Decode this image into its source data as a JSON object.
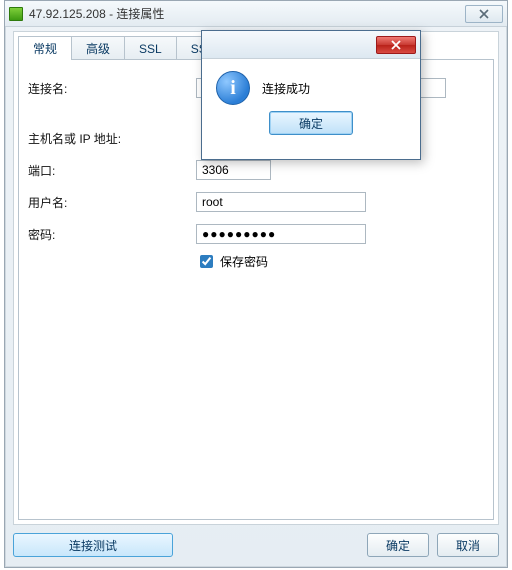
{
  "window": {
    "title": "47.92.125.208 - 连接属性"
  },
  "tabs": [
    {
      "label": "常规",
      "active": true
    },
    {
      "label": "高级",
      "active": false
    },
    {
      "label": "SSL",
      "active": false
    },
    {
      "label": "SSH",
      "active": false
    }
  ],
  "form": {
    "connection_name_label": "连接名:",
    "connection_name_value": "",
    "host_label": "主机名或 IP 地址:",
    "host_value": "",
    "port_label": "端口:",
    "port_value": "3306",
    "username_label": "用户名:",
    "username_value": "root",
    "password_label": "密码:",
    "password_value": "●●●●●●●●●",
    "save_password_label": "保存密码",
    "save_password_checked": true
  },
  "footer": {
    "test_label": "连接测试",
    "ok_label": "确定",
    "cancel_label": "取消"
  },
  "modal": {
    "message": "连接成功",
    "ok_label": "确定"
  }
}
